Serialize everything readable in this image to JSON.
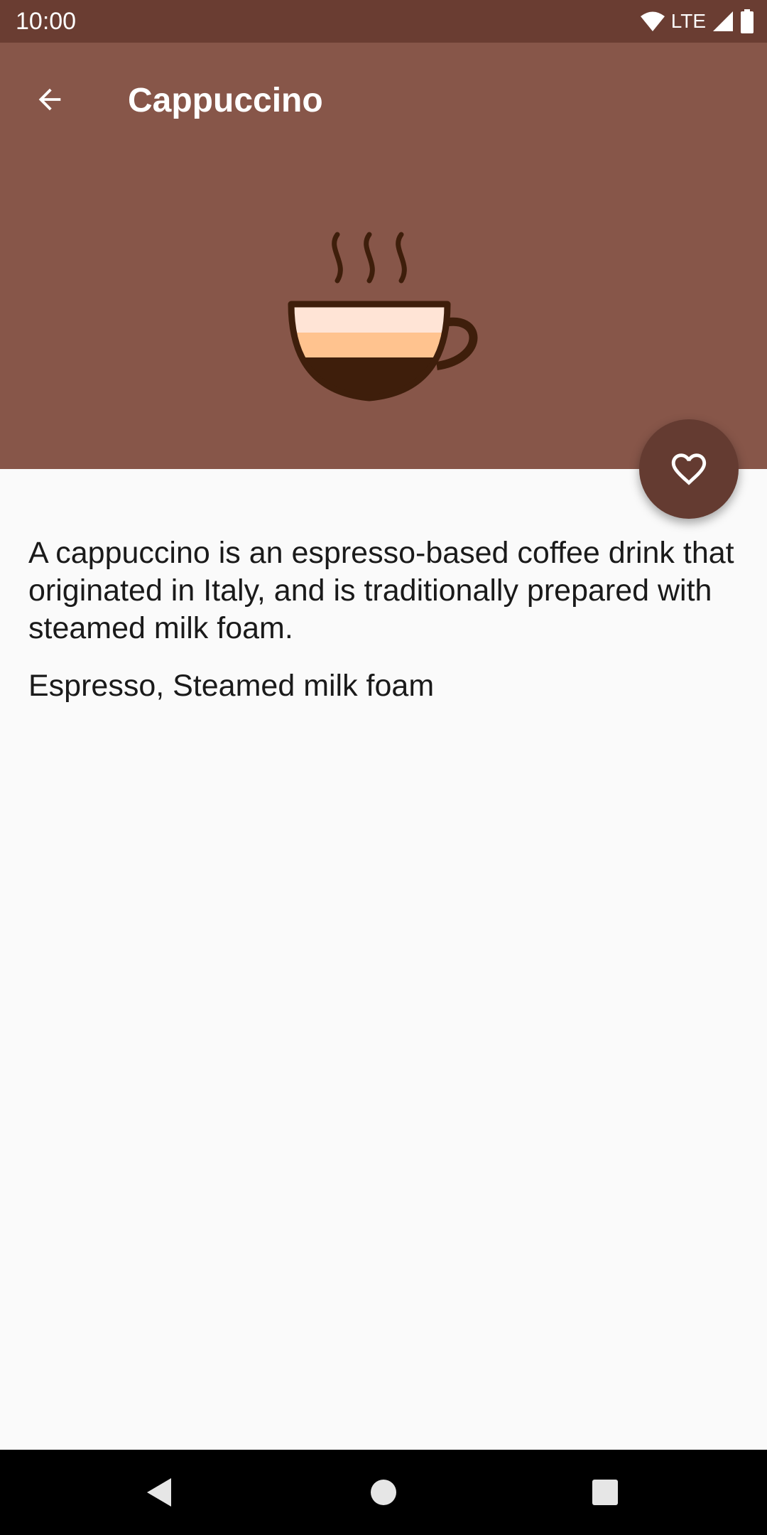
{
  "status_bar": {
    "time": "10:00",
    "network_label": "LTE",
    "icons": [
      "wifi-icon",
      "cell-signal-icon",
      "battery-icon"
    ]
  },
  "app_bar": {
    "title": "Cappuccino",
    "back_icon": "arrow-back-icon"
  },
  "hero": {
    "icon": "coffee-cup-icon",
    "layers": [
      {
        "name": "foam",
        "color": "#FFE4D6"
      },
      {
        "name": "milk",
        "color": "#FFC38F"
      },
      {
        "name": "espresso",
        "color": "#3E1E0B"
      }
    ]
  },
  "fab": {
    "icon": "heart-outline-icon"
  },
  "detail": {
    "description": "A cappuccino is an espresso-based coffee drink that originated in Italy, and is traditionally prepared with steamed milk foam.",
    "ingredients": "Espresso, Steamed milk foam"
  },
  "nav_bar": {
    "buttons": [
      "back-triangle-icon",
      "home-circle-icon",
      "recents-square-icon"
    ]
  },
  "colors": {
    "status_bar": "#6A3D32",
    "header": "#875649",
    "fab": "#643B31",
    "background": "#FAFAFA",
    "text": "#1A1A1A"
  }
}
